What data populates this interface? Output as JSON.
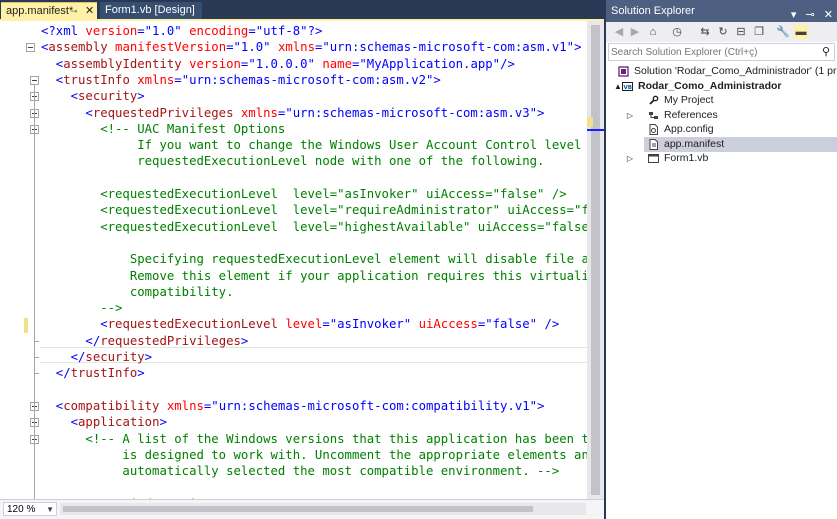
{
  "tabs": [
    {
      "label": "app.manifest*",
      "active": true
    },
    {
      "label": "Form1.vb [Design]",
      "active": false
    }
  ],
  "tab_icons": {
    "pin": "pin-icon",
    "close": "close-icon"
  },
  "code_lines": [
    [
      {
        "t": "<?xml ",
        "c": "t-blue"
      },
      {
        "t": "version",
        "c": "t-attr"
      },
      {
        "t": "=",
        "c": "t-blue"
      },
      {
        "t": "\"1.0\"",
        "c": "t-val"
      },
      {
        "t": " encoding",
        "c": "t-attr"
      },
      {
        "t": "=",
        "c": "t-blue"
      },
      {
        "t": "\"utf-8\"",
        "c": "t-val"
      },
      {
        "t": "?>",
        "c": "t-blue"
      }
    ],
    [
      {
        "t": "<",
        "c": "t-blue"
      },
      {
        "t": "assembly",
        "c": "t-tag"
      },
      {
        "t": " manifestVersion",
        "c": "t-attr"
      },
      {
        "t": "=",
        "c": "t-blue"
      },
      {
        "t": "\"1.0\"",
        "c": "t-val"
      },
      {
        "t": " xmlns",
        "c": "t-attr"
      },
      {
        "t": "=",
        "c": "t-blue"
      },
      {
        "t": "\"urn:schemas-microsoft-com:asm.v1\"",
        "c": "t-val"
      },
      {
        "t": ">",
        "c": "t-blue"
      }
    ],
    [
      {
        "t": "  <",
        "c": "t-blue"
      },
      {
        "t": "assemblyIdentity",
        "c": "t-tag"
      },
      {
        "t": " version",
        "c": "t-attr"
      },
      {
        "t": "=",
        "c": "t-blue"
      },
      {
        "t": "\"1.0.0.0\"",
        "c": "t-val"
      },
      {
        "t": " name",
        "c": "t-attr"
      },
      {
        "t": "=",
        "c": "t-blue"
      },
      {
        "t": "\"MyApplication.app\"",
        "c": "t-val"
      },
      {
        "t": "/>",
        "c": "t-blue"
      }
    ],
    [
      {
        "t": "  <",
        "c": "t-blue"
      },
      {
        "t": "trustInfo",
        "c": "t-tag"
      },
      {
        "t": " xmlns",
        "c": "t-attr"
      },
      {
        "t": "=",
        "c": "t-blue"
      },
      {
        "t": "\"urn:schemas-microsoft-com:asm.v2\"",
        "c": "t-val"
      },
      {
        "t": ">",
        "c": "t-blue"
      }
    ],
    [
      {
        "t": "    <",
        "c": "t-blue"
      },
      {
        "t": "security",
        "c": "t-tag"
      },
      {
        "t": ">",
        "c": "t-blue"
      }
    ],
    [
      {
        "t": "      <",
        "c": "t-blue"
      },
      {
        "t": "requestedPrivileges",
        "c": "t-tag"
      },
      {
        "t": " xmlns",
        "c": "t-attr"
      },
      {
        "t": "=",
        "c": "t-blue"
      },
      {
        "t": "\"urn:schemas-microsoft-com:asm.v3\"",
        "c": "t-val"
      },
      {
        "t": ">",
        "c": "t-blue"
      }
    ],
    [
      {
        "t": "        <!-- UAC Manifest Options",
        "c": "t-com"
      }
    ],
    [
      {
        "t": "             If you want to change the Windows User Account Control level replac",
        "c": "t-com"
      }
    ],
    [
      {
        "t": "             requestedExecutionLevel node with one of the following.",
        "c": "t-com"
      }
    ],
    [
      {
        "t": "",
        "c": "t-com"
      }
    ],
    [
      {
        "t": "        <requestedExecutionLevel  level=\"asInvoker\" uiAccess=\"false\" />",
        "c": "t-com"
      }
    ],
    [
      {
        "t": "        <requestedExecutionLevel  level=\"requireAdministrator\" uiAccess=\"false\"",
        "c": "t-com"
      }
    ],
    [
      {
        "t": "        <requestedExecutionLevel  level=\"highestAvailable\" uiAccess=\"false\" />",
        "c": "t-com"
      }
    ],
    [
      {
        "t": "",
        "c": "t-com"
      }
    ],
    [
      {
        "t": "            Specifying requestedExecutionLevel element will disable file and reg",
        "c": "t-com"
      }
    ],
    [
      {
        "t": "            Remove this element if your application requires this virtualization",
        "c": "t-com"
      }
    ],
    [
      {
        "t": "            compatibility.",
        "c": "t-com"
      }
    ],
    [
      {
        "t": "        -->",
        "c": "t-com"
      }
    ],
    [
      {
        "t": "        <",
        "c": "t-blue"
      },
      {
        "t": "requestedExecutionLevel",
        "c": "t-tag"
      },
      {
        "t": " level",
        "c": "t-attr"
      },
      {
        "t": "=",
        "c": "t-blue"
      },
      {
        "t": "\"asInvoker\"",
        "c": "t-val"
      },
      {
        "t": " uiAccess",
        "c": "t-attr"
      },
      {
        "t": "=",
        "c": "t-blue"
      },
      {
        "t": "\"false\"",
        "c": "t-val"
      },
      {
        "t": " />",
        "c": "t-blue"
      }
    ],
    [
      {
        "t": "      </",
        "c": "t-blue"
      },
      {
        "t": "requestedPrivileges",
        "c": "t-tag"
      },
      {
        "t": ">",
        "c": "t-blue"
      }
    ],
    [
      {
        "t": "    </",
        "c": "t-blue"
      },
      {
        "t": "security",
        "c": "t-tag"
      },
      {
        "t": ">",
        "c": "t-blue"
      }
    ],
    [
      {
        "t": "  </",
        "c": "t-blue"
      },
      {
        "t": "trustInfo",
        "c": "t-tag"
      },
      {
        "t": ">",
        "c": "t-blue"
      }
    ],
    [
      {
        "t": "",
        "c": "t-blue"
      }
    ],
    [
      {
        "t": "  <",
        "c": "t-blue"
      },
      {
        "t": "compatibility",
        "c": "t-tag"
      },
      {
        "t": " xmlns",
        "c": "t-attr"
      },
      {
        "t": "=",
        "c": "t-blue"
      },
      {
        "t": "\"urn:schemas-microsoft-com:compatibility.v1\"",
        "c": "t-val"
      },
      {
        "t": ">",
        "c": "t-blue"
      }
    ],
    [
      {
        "t": "    <",
        "c": "t-blue"
      },
      {
        "t": "application",
        "c": "t-tag"
      },
      {
        "t": ">",
        "c": "t-blue"
      }
    ],
    [
      {
        "t": "      <!-- A list of the Windows versions that this application has been tested",
        "c": "t-com"
      }
    ],
    [
      {
        "t": "           is designed to work with. Uncomment the appropriate elements and Wind",
        "c": "t-com"
      }
    ],
    [
      {
        "t": "           automatically selected the most compatible environment. -->",
        "c": "t-com"
      }
    ],
    [
      {
        "t": "",
        "c": "t-com"
      }
    ],
    [
      {
        "t": "      <!-- Windows Vista -->",
        "c": "t-com"
      }
    ]
  ],
  "zoom": {
    "value": "120 %"
  },
  "solution_explorer": {
    "title": "Solution Explorer",
    "search_placeholder": "Search Solution Explorer (Ctrl+ç)",
    "toolbar_icons": [
      "back-icon",
      "forward-icon",
      "home-icon",
      "history-icon",
      "sync-icon",
      "refresh-icon",
      "collapse-all-icon",
      "show-all-files-icon",
      "properties-icon",
      "preview-icon"
    ],
    "tree": [
      {
        "label": "Solution 'Rodar_Como_Administrador' (1 project)",
        "icon": "solution-icon",
        "expander": "",
        "bold": false,
        "selected": false
      },
      {
        "label": "Rodar_Como_Administrador",
        "icon": "vb-project-icon",
        "expander": "▲",
        "bold": true,
        "selected": false
      },
      {
        "label": "My Project",
        "icon": "wrench-icon",
        "expander": "",
        "bold": false,
        "selected": false
      },
      {
        "label": "References",
        "icon": "references-icon",
        "expander": "▷",
        "bold": false,
        "selected": false
      },
      {
        "label": "App.config",
        "icon": "config-file-icon",
        "expander": "",
        "bold": false,
        "selected": false
      },
      {
        "label": "app.manifest",
        "icon": "manifest-file-icon",
        "expander": "",
        "bold": false,
        "selected": true
      },
      {
        "label": "Form1.vb",
        "icon": "form-icon",
        "expander": "▷",
        "bold": false,
        "selected": false
      }
    ]
  }
}
